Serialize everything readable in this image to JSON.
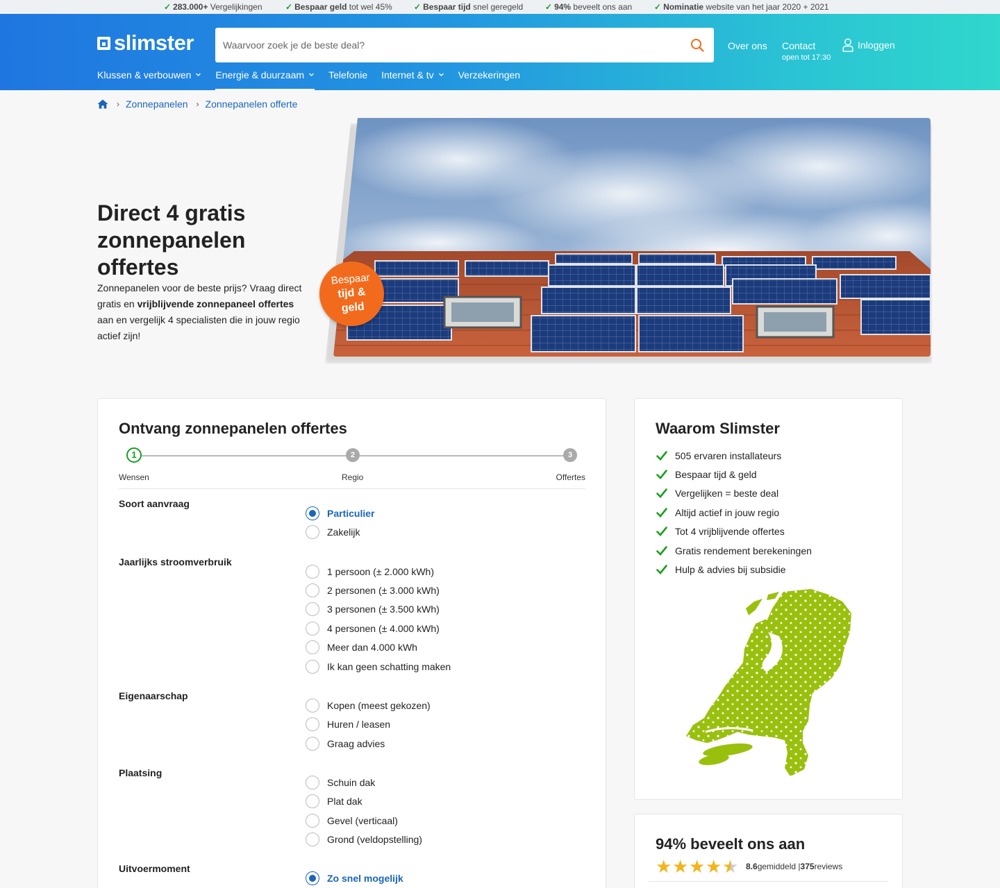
{
  "usps": [
    {
      "bold": "283.000+",
      "text": " Vergelijkingen"
    },
    {
      "bold": "Bespaar geld",
      "text": " tot wel 45%"
    },
    {
      "bold": "Bespaar tijd",
      "text": " snel geregeld"
    },
    {
      "bold": "94%",
      "text": " beveelt ons aan"
    },
    {
      "bold": "Nominatie",
      "text": " website van het jaar 2020 + 2021"
    }
  ],
  "header": {
    "logo": "slimster",
    "search_placeholder": "Waarvoor zoek je de beste deal?",
    "about": "Over ons",
    "contact": "Contact",
    "contact_hours": "open tot 17:30",
    "login": "Inloggen"
  },
  "nav": [
    {
      "label": "Klussen & verbouwen",
      "dropdown": true
    },
    {
      "label": "Energie & duurzaam",
      "dropdown": true,
      "active": true
    },
    {
      "label": "Telefonie",
      "dropdown": false
    },
    {
      "label": "Internet & tv",
      "dropdown": true
    },
    {
      "label": "Verzekeringen",
      "dropdown": false
    }
  ],
  "breadcrumb": [
    "Zonnepanelen",
    "Zonnepanelen offerte"
  ],
  "hero": {
    "title": "Direct 4 gratis zonnepanelen offertes",
    "text_before": "Zonnepanelen voor de beste prijs? Vraag direct gratis en ",
    "text_bold": "vrijblijvende zonnepaneel offertes",
    "text_after": " aan en vergelijk 4 specialisten die in jouw regio actief zijn!",
    "badge_line1": "Bespaar",
    "badge_line2": "tijd &",
    "badge_line3": "geld"
  },
  "form": {
    "title": "Ontvang zonnepanelen offertes",
    "steps": [
      {
        "num": "1",
        "label": "Wensen"
      },
      {
        "num": "2",
        "label": "Regio"
      },
      {
        "num": "3",
        "label": "Offertes"
      }
    ],
    "questions": [
      {
        "label": "Soort aanvraag",
        "options": [
          "Particulier",
          "Zakelijk"
        ],
        "selected": 0
      },
      {
        "label": "Jaarlijks stroomverbruik",
        "options": [
          "1 persoon (± 2.000 kWh)",
          "2 personen (± 3.000 kWh)",
          "3 personen (± 3.500 kWh)",
          "4 personen (± 4.000 kWh)",
          "Meer dan 4.000 kWh",
          "Ik kan geen schatting maken"
        ],
        "selected": -1
      },
      {
        "label": "Eigenaarschap",
        "options": [
          "Kopen (meest gekozen)",
          "Huren / leasen",
          "Graag advies"
        ],
        "selected": -1
      },
      {
        "label": "Plaatsing",
        "options": [
          "Schuin dak",
          "Plat dak",
          "Gevel (verticaal)",
          "Grond (veldopstelling)"
        ],
        "selected": -1
      },
      {
        "label": "Uitvoermoment",
        "options": [
          "Zo snel mogelijk"
        ],
        "selected": 0
      }
    ]
  },
  "why": {
    "title": "Waarom Slimster",
    "items": [
      "505 ervaren installateurs",
      "Bespaar tijd & geld",
      "Vergelijken = beste deal",
      "Altijd actief in jouw regio",
      "Tot 4 vrijblijvende offertes",
      "Gratis rendement berekeningen",
      "Hulp & advies bij subsidie"
    ]
  },
  "reviews": {
    "title": "94% beveelt ons aan",
    "score": "8.6",
    "score_text": " gemiddeld | ",
    "count": "375",
    "count_text": " reviews",
    "stars": 4.5
  },
  "colors": {
    "brand_blue": "#1f76e0",
    "accent_orange": "#f26b1d",
    "check_green": "#18a01c",
    "map_green": "#9ac00e"
  }
}
